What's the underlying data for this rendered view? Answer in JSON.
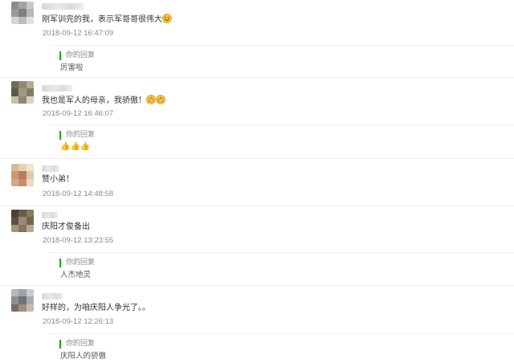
{
  "comments": [
    {
      "text": "刚军训完的我，表示军哥哥很伟大",
      "time": "2018-09-12 16:47:09",
      "reply_label": "你的回复",
      "reply_text": "厉害啦"
    },
    {
      "text": "我也是军人的母亲，我骄傲！",
      "time": "2018-09-12 16:46:07",
      "reply_label": "你的回复",
      "reply_text": "👍👍👍"
    },
    {
      "text": "赞小弟！",
      "time": "2018-09-12 14:48:58"
    },
    {
      "text": "庆阳才俊备出",
      "time": "2018-09-12 13:23:55",
      "reply_label": "你的回复",
      "reply_text": "人杰地灵"
    },
    {
      "text": "好样的，为咱庆阳人争光了。。",
      "time": "2018-09-12 12:26:13",
      "reply_label": "你的回复",
      "reply_text": "庆阳人的骄傲"
    }
  ],
  "emoji_icons": {
    "smile": "smile-emoji-icon",
    "thumbs_up": "thumbs-up-emoji-icon"
  },
  "colors": {
    "reply_marker": "#1aad19",
    "timestamp": "#8a8a8a",
    "divider": "#ececec"
  }
}
